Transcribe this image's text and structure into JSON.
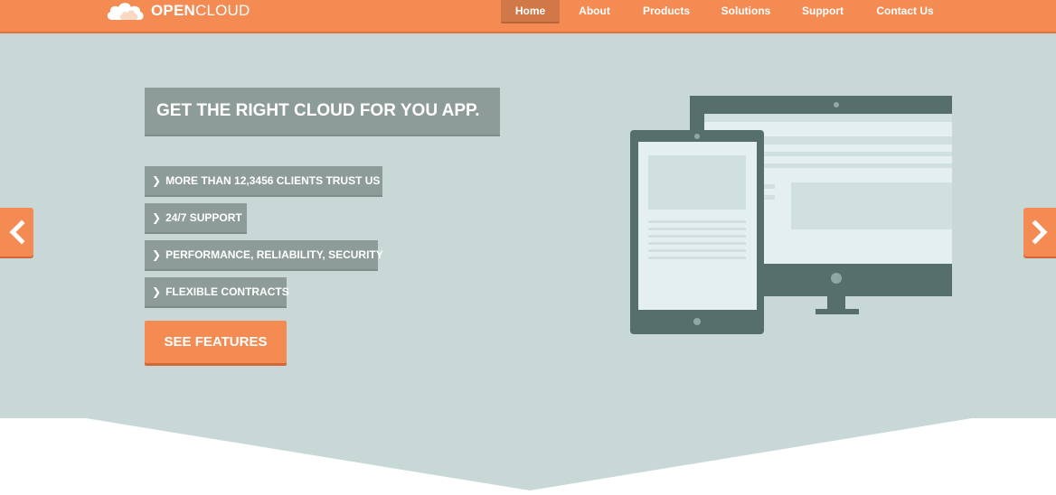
{
  "brand": {
    "name_bold": "OPEN",
    "name_regular": "CLOUD",
    "logo_icon": "cloud-icon"
  },
  "nav": {
    "items": [
      {
        "label": "Home",
        "active": true
      },
      {
        "label": "About",
        "active": false
      },
      {
        "label": "Products",
        "active": false
      },
      {
        "label": "Solutions",
        "active": false
      },
      {
        "label": "Support",
        "active": false
      },
      {
        "label": "Contact Us",
        "active": false
      }
    ]
  },
  "hero": {
    "headline": "GET THE RIGHT CLOUD FOR YOU APP.",
    "features": [
      "MORE THAN 12,3456 CLIENTS TRUST US",
      "24/7 SUPPORT",
      "PERFORMANCE, RELIABILITY, SECURITY",
      "FLEXIBLE CONTRACTS"
    ],
    "feature_icon": "chevron-right-icon",
    "cta_label": "SEE FEATURES"
  },
  "carousel": {
    "prev_icon": "chevron-left-icon",
    "next_icon": "chevron-right-icon"
  },
  "colors": {
    "accent": "#f38b53",
    "hero_bg": "#c7d8d6",
    "label_bg": "#8e9c99",
    "device_frame": "#566e6c",
    "screen": "#e3f0ef"
  }
}
